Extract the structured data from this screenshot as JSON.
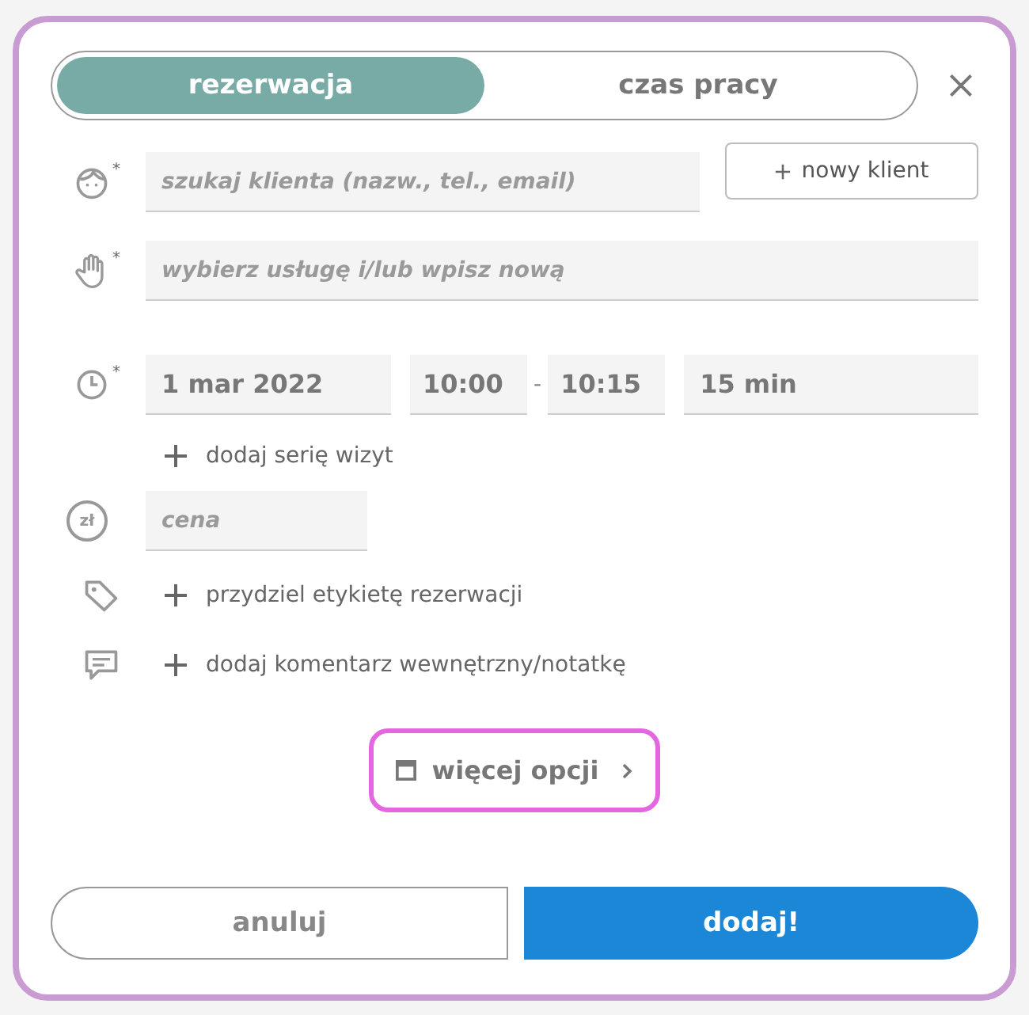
{
  "tabs": [
    {
      "label": "rezerwacja",
      "selected": true
    },
    {
      "label": "czas pracy",
      "selected": false
    }
  ],
  "client": {
    "required_mark": "*",
    "placeholder": "szukaj klienta (nazw., tel., email)",
    "new_client_button": "nowy klient"
  },
  "service": {
    "required_mark": "*",
    "placeholder": "wybierz usługę i/lub wpisz nową"
  },
  "time": {
    "required_mark": "*",
    "date": "1 mar 2022",
    "start": "10:00",
    "separator": "-",
    "end": "10:15",
    "duration": "15 min"
  },
  "add_series": "dodaj serię wizyt",
  "price": {
    "currency": "zł",
    "placeholder": "cena"
  },
  "tag_link": "przydziel etykietę rezerwacji",
  "comment_link": "dodaj komentarz wewnętrzny/notatkę",
  "more_options": {
    "label": "więcej opcji",
    "highlighted": true
  },
  "buttons": [
    {
      "label": "anuluj",
      "kind": "secondary"
    },
    {
      "label": "dodaj!",
      "kind": "primary"
    }
  ]
}
